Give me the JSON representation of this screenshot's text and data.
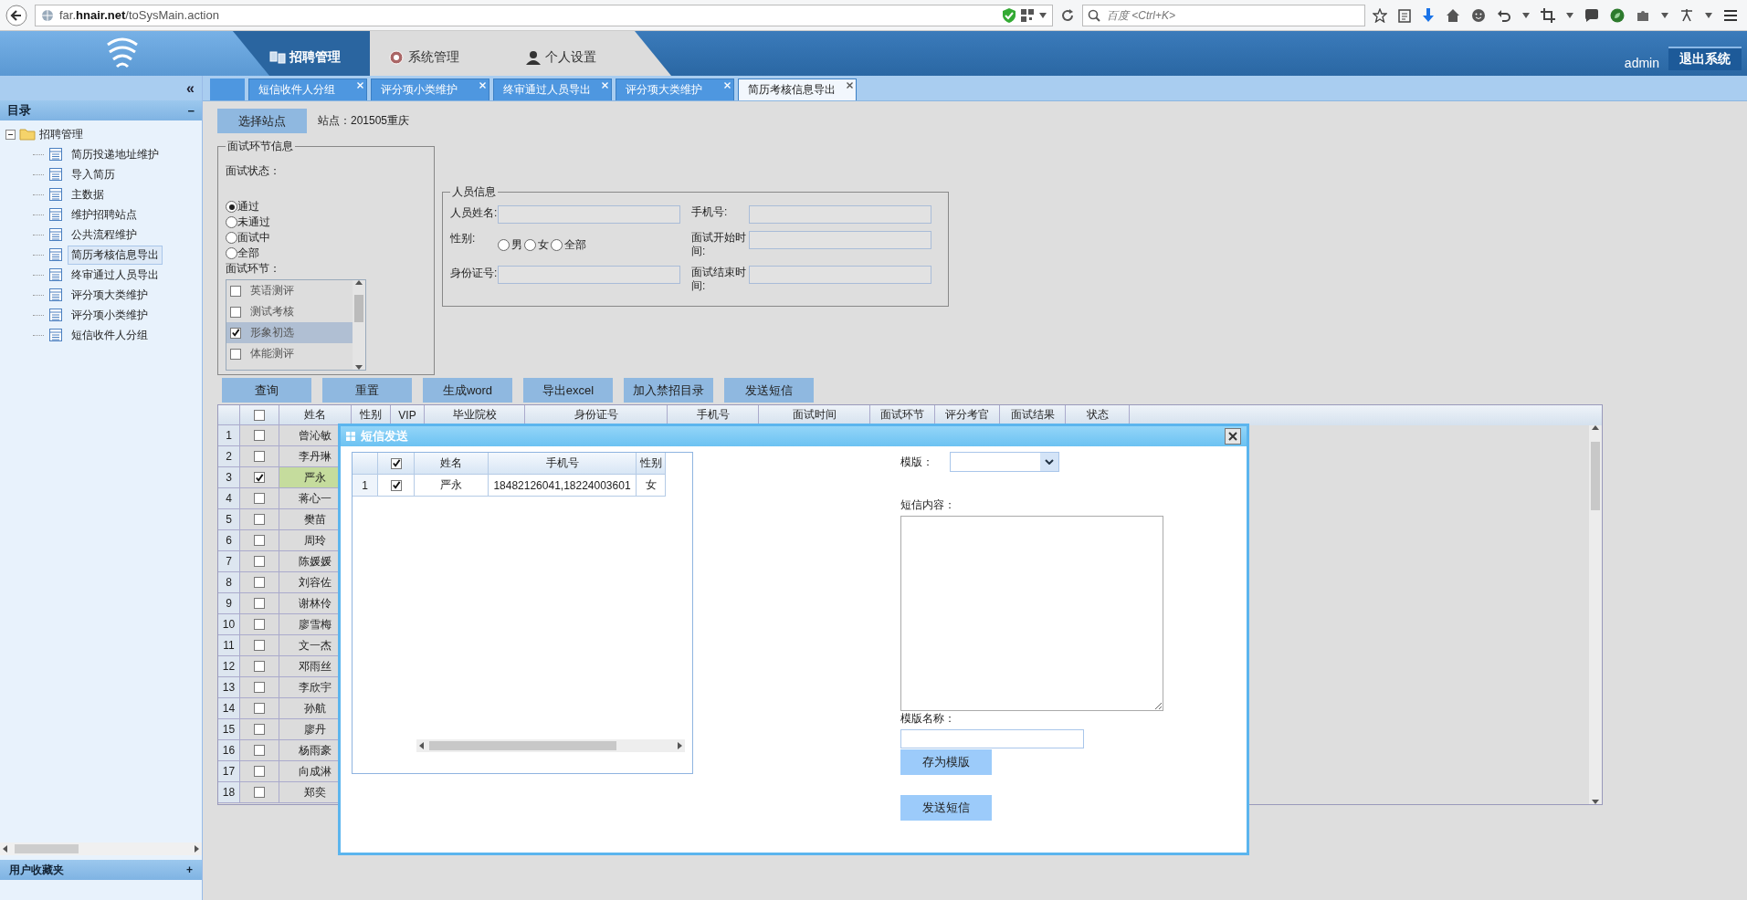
{
  "browser": {
    "url": "far.**hnair.net**/toSysMain.action",
    "search_placeholder": "百度 <Ctrl+K>"
  },
  "header": {
    "nav": [
      {
        "label": "招聘管理",
        "selected": true
      },
      {
        "label": "系统管理",
        "selected": false
      },
      {
        "label": "个人设置",
        "selected": false
      }
    ],
    "user": "admin",
    "logout": "退出系统"
  },
  "sidebar": {
    "collapse": "«",
    "title": "目录",
    "title_toggle": "−",
    "tree": [
      {
        "label": "招聘管理",
        "expanded": true,
        "children": [
          {
            "label": "简历投递地址维护",
            "selected": false
          },
          {
            "label": "导入简历",
            "selected": false
          },
          {
            "label": "主数据",
            "selected": false
          },
          {
            "label": "维护招聘站点",
            "selected": false
          },
          {
            "label": "公共流程维护",
            "selected": false
          },
          {
            "label": "简历考核信息导出",
            "selected": true
          },
          {
            "label": "终审通过人员导出",
            "selected": false
          },
          {
            "label": "评分项大类维护",
            "selected": false
          },
          {
            "label": "评分项小类维护",
            "selected": false
          },
          {
            "label": "短信收件人分组",
            "selected": false
          }
        ]
      }
    ],
    "footer": "用户收藏夹",
    "footer_toggle": "+"
  },
  "tabs": [
    {
      "label": "短信收件人分组",
      "selected": false
    },
    {
      "label": "评分项小类维护",
      "selected": false
    },
    {
      "label": "终审通过人员导出",
      "selected": false
    },
    {
      "label": "评分项大类维护",
      "selected": false
    },
    {
      "label": "简历考核信息导出",
      "selected": true
    }
  ],
  "form": {
    "station_button": "选择站点",
    "station": "站点：201505重庆",
    "interview": {
      "legend": "面试环节信息",
      "status_label": "面试状态：",
      "statuses": [
        {
          "label": "通过",
          "selected": true
        },
        {
          "label": "未通过",
          "selected": false
        },
        {
          "label": "面试中",
          "selected": false
        },
        {
          "label": "全部",
          "selected": false
        }
      ],
      "stage_label": "面试环节：",
      "stages": [
        {
          "label": "英语测评",
          "checked": false,
          "selected": false
        },
        {
          "label": "测试考核",
          "checked": false,
          "selected": false
        },
        {
          "label": "形象初选",
          "checked": true,
          "selected": true
        },
        {
          "label": "体能测评",
          "checked": false,
          "selected": false
        }
      ]
    },
    "person": {
      "legend": "人员信息",
      "name_label": "人员姓名:",
      "gender_label": "性别:",
      "genders": [
        {
          "label": "男",
          "selected": false
        },
        {
          "label": "女",
          "selected": false
        },
        {
          "label": "全部",
          "selected": false
        }
      ],
      "id_label": "身份证号:",
      "phone_label": "手机号:",
      "start_label": "面试开始时间:",
      "end_label": "面试结束时间:"
    }
  },
  "actions": [
    "查询",
    "重置",
    "生成word",
    "导出excel",
    "加入禁招目录",
    "发送短信"
  ],
  "table": {
    "all_checked": false,
    "columns": [
      "姓名",
      "性别",
      "VIP",
      "毕业院校",
      "身份证号",
      "手机号",
      "面试时间",
      "面试环节",
      "评分考官",
      "面试结果",
      "状态"
    ],
    "rows": [
      {
        "no": "1",
        "name": "曾沁敏",
        "checked": false,
        "selected": false
      },
      {
        "no": "2",
        "name": "李丹琳",
        "checked": false,
        "selected": false
      },
      {
        "no": "3",
        "name": "严永",
        "checked": true,
        "selected": true
      },
      {
        "no": "4",
        "name": "蒋心一",
        "checked": false,
        "selected": false
      },
      {
        "no": "5",
        "name": "樊苗",
        "checked": false,
        "selected": false
      },
      {
        "no": "6",
        "name": "周玲",
        "checked": false,
        "selected": false
      },
      {
        "no": "7",
        "name": "陈媛媛",
        "checked": false,
        "selected": false
      },
      {
        "no": "8",
        "name": "刘容佐",
        "checked": false,
        "selected": false
      },
      {
        "no": "9",
        "name": "谢林伶",
        "checked": false,
        "selected": false
      },
      {
        "no": "10",
        "name": "廖雪梅",
        "checked": false,
        "selected": false
      },
      {
        "no": "11",
        "name": "文一杰",
        "checked": false,
        "selected": false
      },
      {
        "no": "12",
        "name": "邓雨丝",
        "checked": false,
        "selected": false
      },
      {
        "no": "13",
        "name": "李欣宇",
        "checked": false,
        "selected": false
      },
      {
        "no": "14",
        "name": "孙航",
        "checked": false,
        "selected": false
      },
      {
        "no": "15",
        "name": "廖丹",
        "checked": false,
        "selected": false
      },
      {
        "no": "16",
        "name": "杨雨豪",
        "checked": false,
        "selected": false
      },
      {
        "no": "17",
        "name": "向成淋",
        "checked": false,
        "selected": false
      },
      {
        "no": "18",
        "name": "郑奕",
        "checked": false,
        "selected": false
      }
    ]
  },
  "dialog": {
    "title": "短信发送",
    "grid": {
      "all_checked": true,
      "columns": [
        "姓名",
        "手机号",
        "性别"
      ],
      "rows": [
        {
          "no": "1",
          "checked": true,
          "name": "严永",
          "phone": "18482126041,18224003601",
          "gender": "女"
        }
      ]
    },
    "template_label": "模版：",
    "content_label": "短信内容：",
    "template_name_label": "模版名称：",
    "save_button": "存为模版",
    "send_button": "发送短信"
  }
}
